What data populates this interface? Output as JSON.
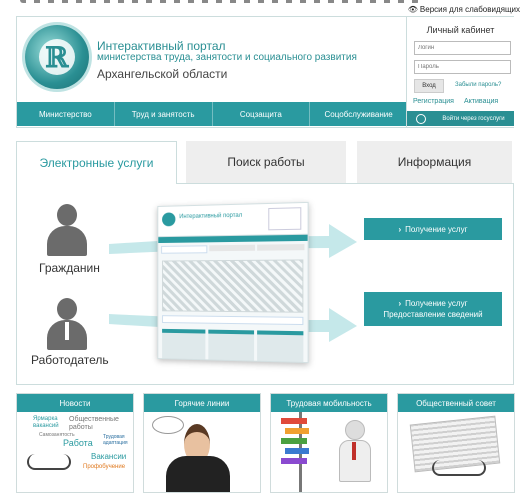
{
  "top": {
    "visually_impaired_label": "Версия для слабовидящих"
  },
  "portal": {
    "title_line1": "Интерактивный портал",
    "title_line2": "министерства труда, занятости и социального развития",
    "region": "Архангельской области"
  },
  "nav": {
    "items": [
      {
        "label": "Министерство"
      },
      {
        "label": "Труд и занятость"
      },
      {
        "label": "Соцзащита"
      },
      {
        "label": "Соцобслуживание"
      }
    ]
  },
  "cabinet": {
    "title": "Личный кабинет",
    "login_placeholder": "Логин",
    "password_placeholder": "Пароль",
    "enter_label": "Вход",
    "forgot_label": "Забыли пароль?",
    "register_label": "Регистрация",
    "activate_label": "Активация",
    "gosuslugi_label": "Войти через госуслуги"
  },
  "tabs": [
    {
      "label": "Электронные услуги",
      "active": true
    },
    {
      "label": "Поиск работы",
      "active": false
    },
    {
      "label": "Информация",
      "active": false
    }
  ],
  "services": {
    "citizen_label": "Гражданин",
    "employer_label": "Работодатель",
    "citizen_button": "Получение услуг",
    "employer_button_line1": "Получение услуг",
    "employer_button_line2": "Предоставление сведений",
    "preview_title": "Интерактивный портал"
  },
  "tiles": [
    {
      "label": "Новости"
    },
    {
      "label": "Горячие линии"
    },
    {
      "label": "Трудовая мобильность"
    },
    {
      "label": "Общественный совет"
    }
  ],
  "news_cloud": [
    {
      "text": "Ярмарка вакансий",
      "color": "#2a9aa0"
    },
    {
      "text": "Общественные работы",
      "color": "#777777"
    },
    {
      "text": "Самозанятость",
      "color": "#777777"
    },
    {
      "text": "Работа",
      "color": "#2a9aa0"
    },
    {
      "text": "Трудовая адаптация",
      "color": "#2a6fa0"
    },
    {
      "text": "Вакансии",
      "color": "#2a9aa0"
    },
    {
      "text": "Профобучение",
      "color": "#e07a20"
    }
  ],
  "colors": {
    "accent": "#2a9aa0",
    "text": "#333333",
    "tab_inactive": "#eeeeee"
  }
}
